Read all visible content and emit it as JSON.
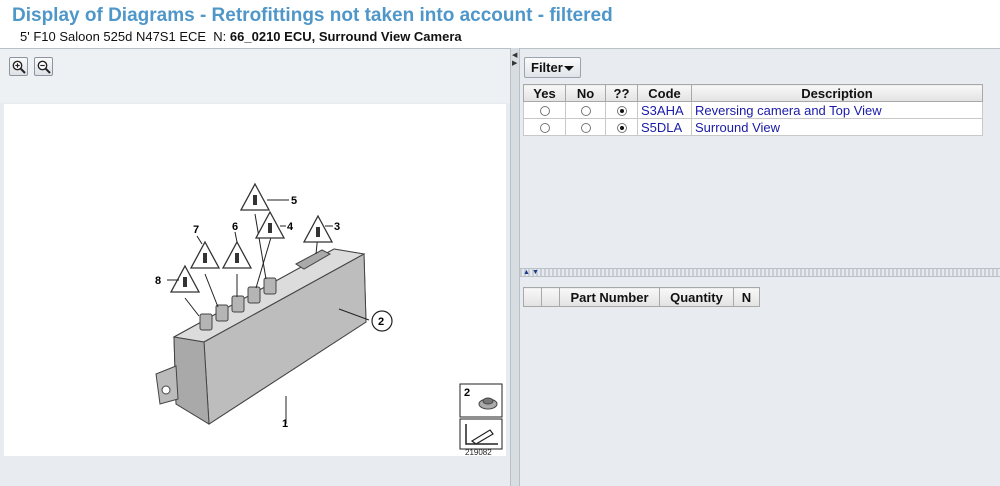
{
  "header": {
    "title": "Display of Diagrams - Retrofittings not taken into account - filtered",
    "vehicle": "5' F10 Saloon 525d N47S1 ECE",
    "n_label": "N:",
    "group": "66_0210 ECU, Surround View Camera"
  },
  "zoom": {
    "zoom_in": "zoom-in-icon",
    "zoom_out": "zoom-out-icon"
  },
  "diagram": {
    "callouts": [
      "1",
      "2",
      "3",
      "4",
      "5",
      "6",
      "7",
      "8"
    ],
    "thumbnail_label": "2",
    "image_number": "219082"
  },
  "filter": {
    "button_label": "Filter",
    "columns": [
      "Yes",
      "No",
      "??",
      "Code",
      "Description"
    ],
    "rows": [
      {
        "selected": "??",
        "code": "S3AHA",
        "description": "Reversing camera and Top View"
      },
      {
        "selected": "??",
        "code": "S5DLA",
        "description": "Surround View"
      }
    ]
  },
  "parts": {
    "columns": [
      "",
      "",
      "Part Number",
      "Quantity",
      "N"
    ]
  },
  "colors": {
    "title": "#4f97c9",
    "link": "#1a1aa8",
    "panel_bg": "#e8ecf0"
  }
}
